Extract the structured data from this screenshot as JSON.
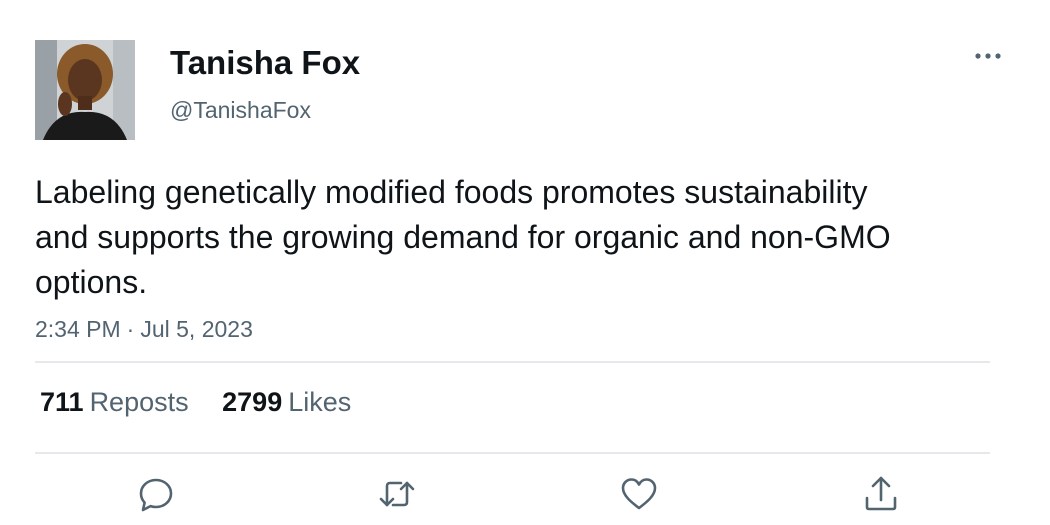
{
  "author": {
    "display_name": "Tanisha Fox",
    "handle": "@TanishaFox",
    "avatar_icon": "user-avatar-photo"
  },
  "tweet": {
    "text": "Labeling genetically modified foods promotes sustainability and supports the growing demand for organic and non-GMO options.",
    "time": "2:34 PM",
    "separator": "·",
    "date": "Jul 5, 2023"
  },
  "stats": {
    "reposts_count": "711",
    "reposts_label": "Reposts",
    "likes_count": "2799",
    "likes_label": "Likes"
  },
  "actions": {
    "reply_icon": "reply-icon",
    "repost_icon": "repost-icon",
    "like_icon": "heart-icon",
    "share_icon": "share-icon",
    "more_icon": "more-options-icon"
  },
  "colors": {
    "text_primary": "#0f1419",
    "text_secondary": "#536471",
    "divider": "#e6e9eb"
  }
}
